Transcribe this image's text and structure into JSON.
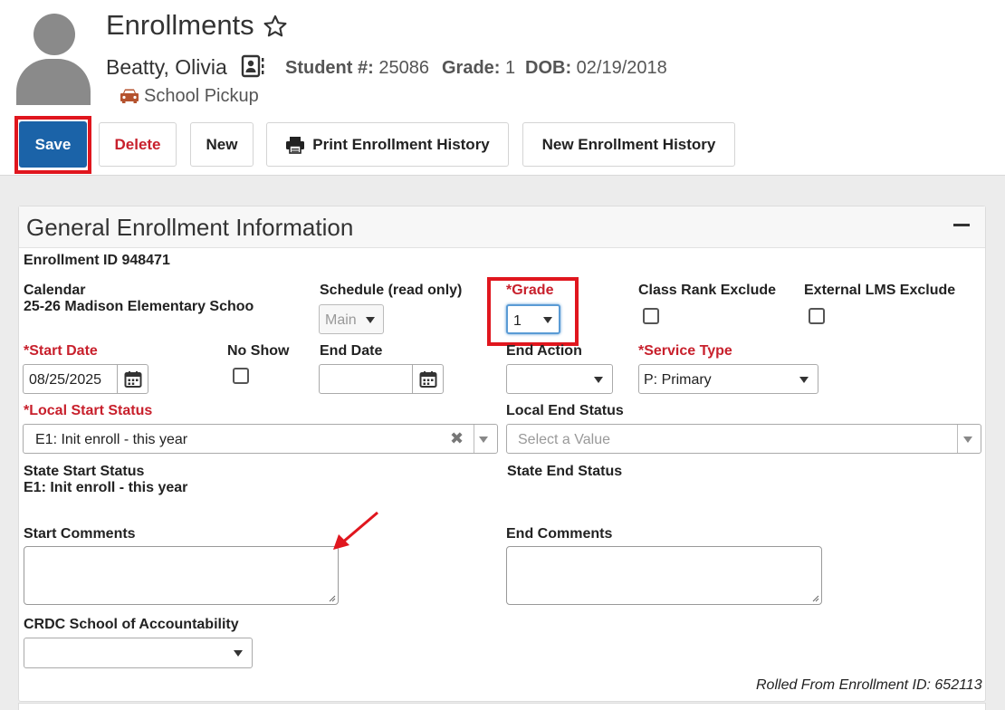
{
  "header": {
    "page_title": "Enrollments",
    "student_name": "Beatty, Olivia",
    "student_number_label": "Student #:",
    "student_number": "25086",
    "grade_label": "Grade:",
    "grade": "1",
    "dob_label": "DOB:",
    "dob": "02/19/2018",
    "pickup_label": "School Pickup",
    "pickup_icon": "car-icon",
    "pickup_color": "#b5532f"
  },
  "toolbar": {
    "save_label": "Save",
    "delete_label": "Delete",
    "new_label": "New",
    "print_label": "Print Enrollment History",
    "new_history_label": "New Enrollment History",
    "save_color": "#1b63a8",
    "highlight_color": "#e0161e"
  },
  "panel": {
    "title": "General Enrollment Information",
    "enrollment_id": "Enrollment ID 948471",
    "calendar_label": "Calendar",
    "calendar_value": "25-26 Madison Elementary Schoo",
    "schedule_label": "Schedule (read only)",
    "schedule_value": "Main",
    "grade_label": "*Grade",
    "grade_value": "1",
    "class_rank_label": "Class Rank Exclude",
    "external_lms_label": "External LMS Exclude",
    "start_date_label": "*Start Date",
    "start_date_value": "08/25/2025",
    "no_show_label": "No Show",
    "end_date_label": "End Date",
    "end_date_value": "",
    "end_action_label": "End Action",
    "end_action_value": "",
    "service_type_label": "*Service Type",
    "service_type_value": "P: Primary",
    "local_start_status_label": "*Local Start Status",
    "local_start_status_value": "E1: Init enroll - this year",
    "local_end_status_label": "Local End Status",
    "local_end_status_placeholder": "Select a Value",
    "state_start_status_label": "State Start Status",
    "state_start_status_value": "E1: Init enroll - this year",
    "state_end_status_label": "State End Status",
    "start_comments_label": "Start Comments",
    "end_comments_label": "End Comments",
    "crdc_label": "CRDC School of Accountability",
    "crdc_value": "",
    "rolled_from": "Rolled From Enrollment ID: 652113"
  }
}
